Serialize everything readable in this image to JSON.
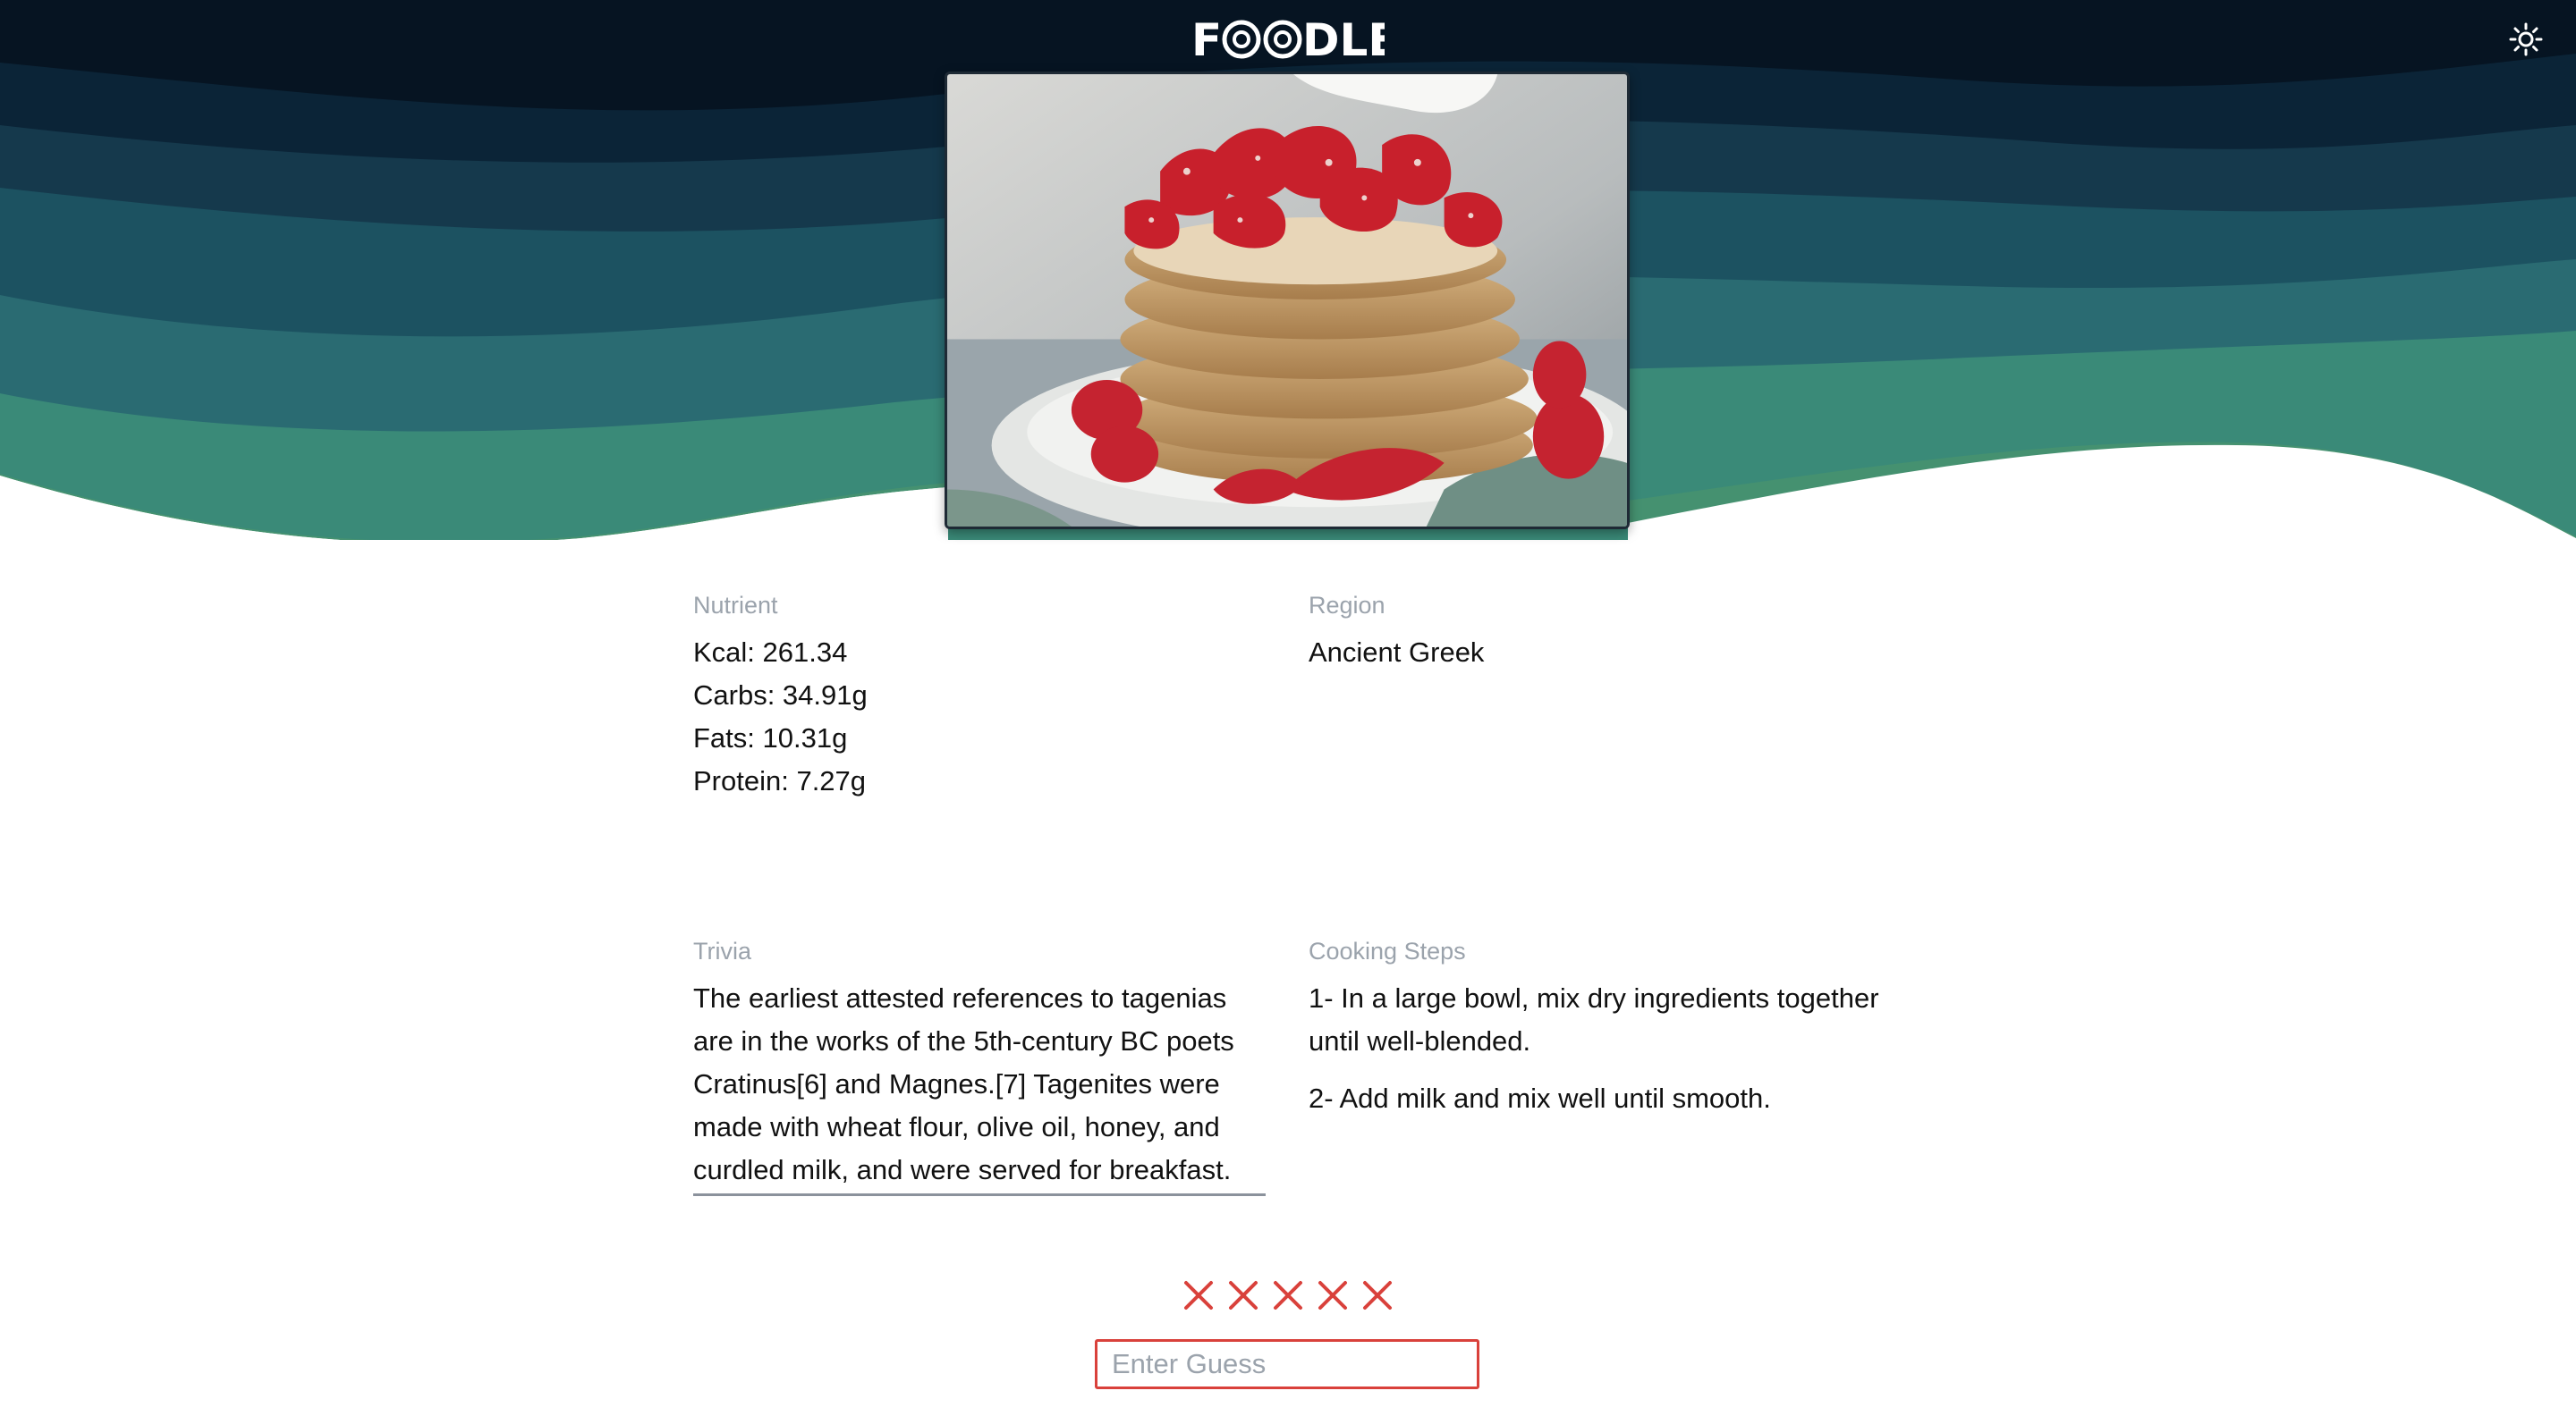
{
  "header": {
    "logo_text": "FOODLE",
    "theme_toggle_icon": "sun-icon"
  },
  "colors": {
    "header_bg": "#061422",
    "wave_1": "#0b2437",
    "wave_2": "#15394c",
    "wave_3": "#1c5261",
    "wave_4": "#2a6b72",
    "wave_5": "#3a8a78",
    "wave_6": "#459170",
    "miss_mark": "#d9413b",
    "input_border": "#d9413b"
  },
  "clues": {
    "nutrient": {
      "label": "Nutrient",
      "lines": [
        "Kcal: 261.34",
        "Carbs: 34.91g",
        "Fats: 10.31g",
        "Protein: 7.27g"
      ]
    },
    "region": {
      "label": "Region",
      "value": "Ancient Greek"
    },
    "trivia": {
      "label": "Trivia",
      "text": "The earliest attested references to tagenias are in the works of the 5th-century BC poets Cratinus[6] and Magnes.[7] Tagenites were made with wheat flour, olive oil, honey, and curdled milk, and were served for breakfast."
    },
    "steps": {
      "label": "Cooking Steps",
      "items": [
        "1- In a large bowl, mix dry ingredients together until well-blended.",
        "2- Add milk and mix well until smooth."
      ]
    }
  },
  "guesses": {
    "total": 5,
    "misses": 5,
    "miss_icon": "x-icon"
  },
  "guess_input": {
    "placeholder": "Enter Guess",
    "value": ""
  }
}
